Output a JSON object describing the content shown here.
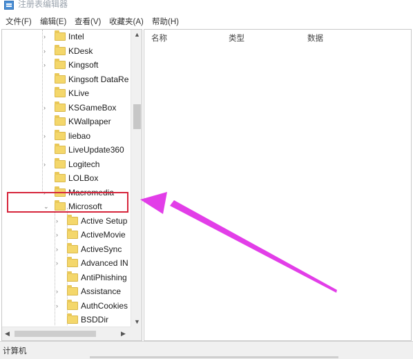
{
  "window": {
    "title": "注册表编辑器"
  },
  "menu": [
    "文件(F)",
    "编辑(E)",
    "查看(V)",
    "收藏夹(A)",
    "帮助(H)"
  ],
  "columns": [
    "名称",
    "类型",
    "数据"
  ],
  "tree": [
    {
      "label": "Intel",
      "expandable": true
    },
    {
      "label": "KDesk",
      "expandable": true
    },
    {
      "label": "Kingsoft",
      "expandable": true
    },
    {
      "label": "Kingsoft DataRe",
      "expandable": false
    },
    {
      "label": "KLive",
      "expandable": false
    },
    {
      "label": "KSGameBox",
      "expandable": true
    },
    {
      "label": "KWallpaper",
      "expandable": false
    },
    {
      "label": "liebao",
      "expandable": true
    },
    {
      "label": "LiveUpdate360",
      "expandable": false
    },
    {
      "label": "Logitech",
      "expandable": true
    },
    {
      "label": "LOLBox",
      "expandable": false
    },
    {
      "label": "Macromedia",
      "expandable": true
    },
    {
      "label": "Microsoft",
      "expandable": true,
      "expanded": true
    },
    {
      "label": "Active Setup",
      "expandable": true
    },
    {
      "label": "ActiveMovie",
      "expandable": true
    },
    {
      "label": "ActiveSync",
      "expandable": true
    },
    {
      "label": "Advanced IN",
      "expandable": true
    },
    {
      "label": "AntiPhishing",
      "expandable": false
    },
    {
      "label": "Assistance",
      "expandable": true
    },
    {
      "label": "AuthCookies",
      "expandable": true
    },
    {
      "label": "BSDDir",
      "expandable": false
    }
  ],
  "status": {
    "path": "计算机"
  },
  "annotation": {
    "highlight_color": "#d6243a",
    "arrow_color": "#e23ee8",
    "highlighted_key": "Microsoft"
  }
}
